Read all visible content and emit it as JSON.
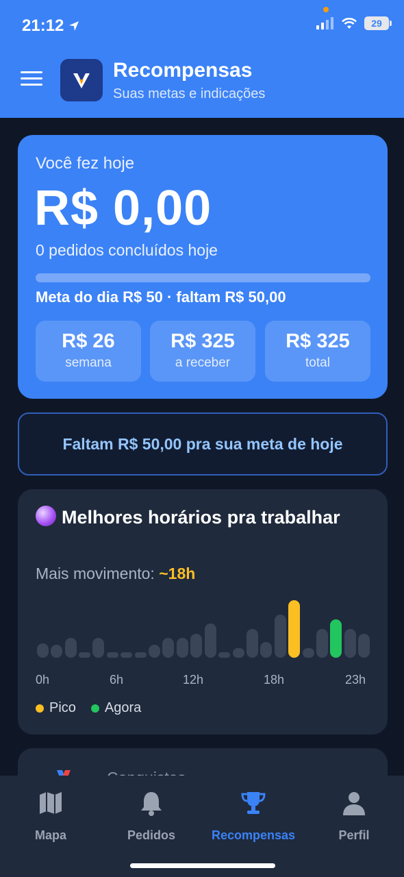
{
  "status_bar": {
    "time": "21:12",
    "battery": "29"
  },
  "header": {
    "title": "Recompensas",
    "subtitle": "Suas metas e indicações"
  },
  "today": {
    "label": "Você fez hoje",
    "value": "R$ 0,00",
    "orders": "0 pedidos concluídos hoje",
    "progress": 0,
    "meta_line": "Meta do dia R$ 50 · faltam R$ 50,00",
    "stats": [
      {
        "value": "R$ 26",
        "label": "semana"
      },
      {
        "value": "R$ 325",
        "label": "a receber"
      },
      {
        "value": "R$ 325",
        "label": "total"
      }
    ]
  },
  "goal_banner": {
    "text": "Faltam R$ 50,00 pra sua meta de hoje"
  },
  "hours": {
    "title": "Melhores horários pra trabalhar",
    "peak_label": "Mais movimento:",
    "peak_value": "~18h",
    "ticks": [
      "0h",
      "6h",
      "12h",
      "18h",
      "23h"
    ],
    "legend": [
      {
        "label": "Pico",
        "color": "#fbbf24"
      },
      {
        "label": "Agora",
        "color": "#22c55e"
      }
    ],
    "chart_data": {
      "type": "bar",
      "categories": [
        "0h",
        "1h",
        "2h",
        "3h",
        "4h",
        "5h",
        "6h",
        "7h",
        "8h",
        "9h",
        "10h",
        "11h",
        "12h",
        "13h",
        "14h",
        "15h",
        "16h",
        "17h",
        "18h",
        "19h",
        "20h",
        "21h",
        "22h",
        "23h"
      ],
      "values": [
        22,
        20,
        30,
        8,
        30,
        8,
        5,
        5,
        20,
        30,
        30,
        36,
        52,
        8,
        15,
        44,
        24,
        66,
        88,
        15,
        44,
        58,
        44,
        36
      ],
      "peak_index": 18,
      "now_index": 21,
      "colors": {
        "default": "#3a4558",
        "peak": "#fbbf24",
        "now": "#22c55e"
      }
    }
  },
  "next_card": {
    "title": "Conquistas"
  },
  "nav": {
    "items": [
      {
        "label": "Mapa"
      },
      {
        "label": "Pedidos"
      },
      {
        "label": "Recompensas"
      },
      {
        "label": "Perfil"
      }
    ]
  }
}
